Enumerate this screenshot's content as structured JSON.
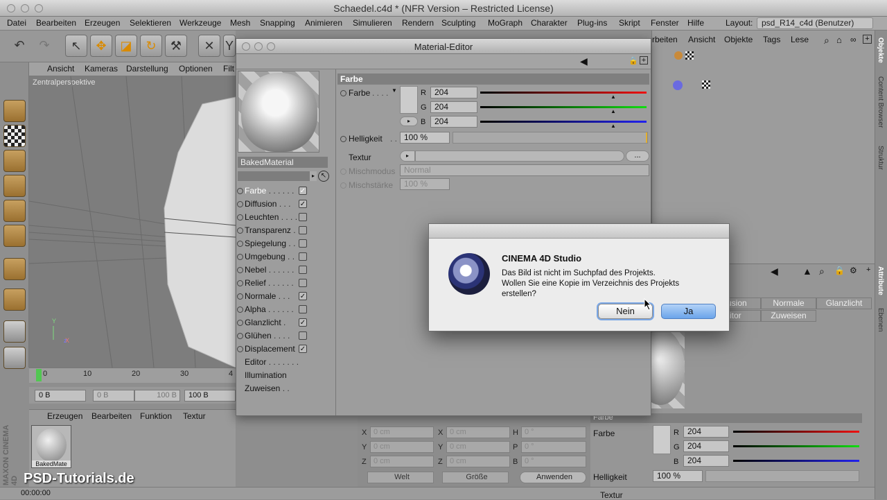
{
  "window": {
    "title": "Schaedel.c4d * (NFR Version – Restricted License)"
  },
  "menu": [
    "Datei",
    "Bearbeiten",
    "Erzeugen",
    "Selektieren",
    "Werkzeuge",
    "Mesh",
    "Snapping",
    "Animieren",
    "Simulieren",
    "Rendern",
    "Sculpting",
    "MoGraph",
    "Charakter",
    "Plug-ins",
    "Skript",
    "Fenster",
    "Hilfe"
  ],
  "layout": {
    "label": "Layout:",
    "value": "psd_R14_c4d (Benutzer)"
  },
  "viewport": {
    "menu": [
      "Ansicht",
      "Kameras",
      "Darstellung",
      "Optionen",
      "Filt"
    ],
    "label": "Zentralperspektive"
  },
  "timeline": {
    "ticks": [
      "0",
      "10",
      "20",
      "30",
      "4"
    ]
  },
  "frames": {
    "start": "0 B",
    "range_start": "0 B",
    "range_end": "100 B",
    "end": "100 B"
  },
  "material_manager": {
    "menu": [
      "Erzeugen",
      "Bearbeiten",
      "Funktion",
      "Textur"
    ],
    "thumb_label": "BakedMate"
  },
  "status": {
    "time": "00:00:00"
  },
  "objects_menu": [
    "rbeiten",
    "Ansicht",
    "Objekte",
    "Tags",
    "Lese"
  ],
  "side_tabs": [
    "Objekte",
    "Content Browser",
    "Struktur",
    "Attribute",
    "Ebenen"
  ],
  "attr_tabs": [
    "usion",
    "Normale",
    "Glanzlicht",
    "itor",
    "Zuweisen"
  ],
  "attr_color": {
    "section": "Farbe",
    "label": "Farbe",
    "r": "204",
    "g": "204",
    "b": "204",
    "brightness_label": "Helligkeit",
    "brightness": "100 %",
    "texture_label": "Textur"
  },
  "coords": {
    "rows": [
      {
        "a": "X",
        "av": "0 cm",
        "b": "X",
        "bv": "0 cm",
        "c": "H",
        "cv": "0 °"
      },
      {
        "a": "Y",
        "av": "0 cm",
        "b": "Y",
        "bv": "0 cm",
        "c": "P",
        "cv": "0 °"
      },
      {
        "a": "Z",
        "av": "0 cm",
        "b": "Z",
        "bv": "0 cm",
        "c": "B",
        "cv": "0 °"
      }
    ],
    "world": "Welt",
    "size": "Größe",
    "apply": "Anwenden"
  },
  "material_editor": {
    "title": "Material-Editor",
    "material_name": "BakedMaterial",
    "channels": [
      {
        "label": "Farbe",
        "dots": " . . . . . .",
        "checked": true,
        "active": true
      },
      {
        "label": "Diffusion",
        "dots": " . . .",
        "checked": true
      },
      {
        "label": "Leuchten",
        "dots": " . . . .",
        "checked": false
      },
      {
        "label": "Transparenz",
        "dots": " .",
        "checked": false
      },
      {
        "label": "Spiegelung",
        "dots": " . .",
        "checked": false
      },
      {
        "label": "Umgebung",
        "dots": " . .",
        "checked": false
      },
      {
        "label": "Nebel",
        "dots": " . . . . . .",
        "checked": false
      },
      {
        "label": "Relief",
        "dots": " . . . . . .",
        "checked": false
      },
      {
        "label": "Normale",
        "dots": " . . .",
        "checked": true
      },
      {
        "label": "Alpha",
        "dots": " . . . . . .",
        "checked": false
      },
      {
        "label": "Glanzlicht",
        "dots": " .",
        "checked": true
      },
      {
        "label": "Glühen",
        "dots": " . . . .",
        "checked": false
      },
      {
        "label": "Displacement",
        "dots": "",
        "checked": true
      }
    ],
    "extra_items": [
      {
        "label": "Editor",
        "dots": " . . . . . . ."
      },
      {
        "label": "Illumination",
        "dots": ""
      },
      {
        "label": "Zuweisen",
        "dots": " . ."
      }
    ],
    "props": {
      "section": "Farbe",
      "color_label": "Farbe",
      "color_dots": ". . . .",
      "r_label": "R",
      "r": "204",
      "g_label": "G",
      "g": "204",
      "b_label": "B",
      "b": "204",
      "brightness_label": "Helligkeit",
      "brightness_dots": ". .",
      "brightness": "100 %",
      "brightness_value": 1.0,
      "texture_label": "Textur",
      "texture_more": "...",
      "blend_mode_label": "Mischmodus",
      "blend_mode": "Normal",
      "blend_strength_label": "Mischstärke",
      "blend_strength": "100 %"
    }
  },
  "dialog": {
    "title": "CINEMA 4D Studio",
    "message_line1": "Das Bild ist nicht im Suchpfad des Projekts.",
    "message_line2": "Wollen Sie eine Kopie im Verzeichnis des Projekts",
    "message_line3": "erstellen?",
    "no": "Nein",
    "yes": "Ja"
  },
  "branding": {
    "watermark": "PSD-Tutorials.de",
    "maxon": "MAXON CINEMA 4D"
  }
}
